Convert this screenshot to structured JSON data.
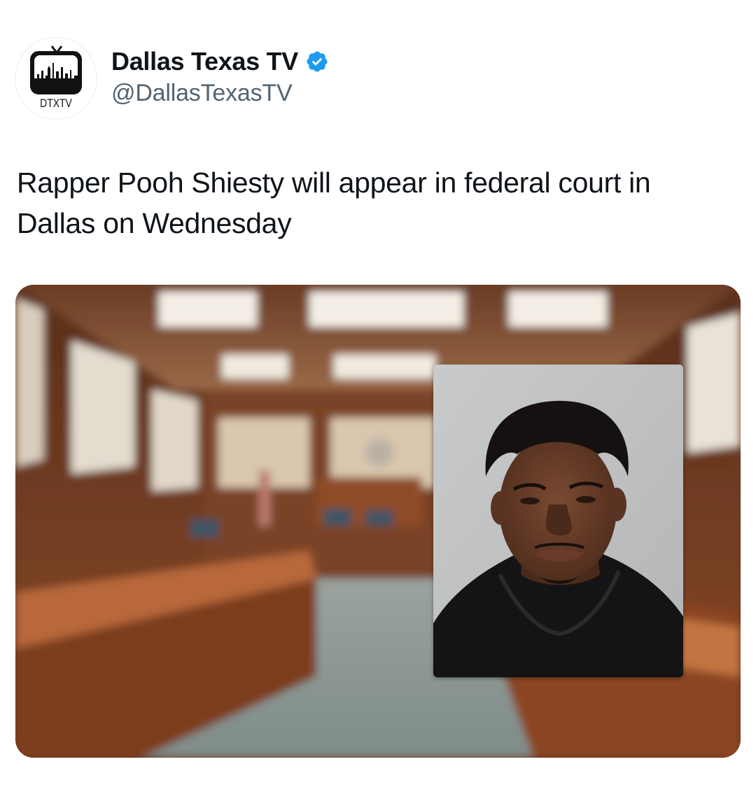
{
  "account": {
    "display_name": "Dallas Texas TV",
    "handle": "@DallasTexasTV",
    "avatar_text": "DTXTV",
    "verified_icon": "verified-badge-icon",
    "verified_color": "#1d9bf0"
  },
  "tweet": {
    "text": "Rapper Pooh Shiesty will appear in federal court in Dallas on Wednesday"
  },
  "media": {
    "background": "courtroom-photo",
    "inset": "mugshot-photo"
  },
  "colors": {
    "text": "#0f1419",
    "secondary_text": "#536471"
  }
}
